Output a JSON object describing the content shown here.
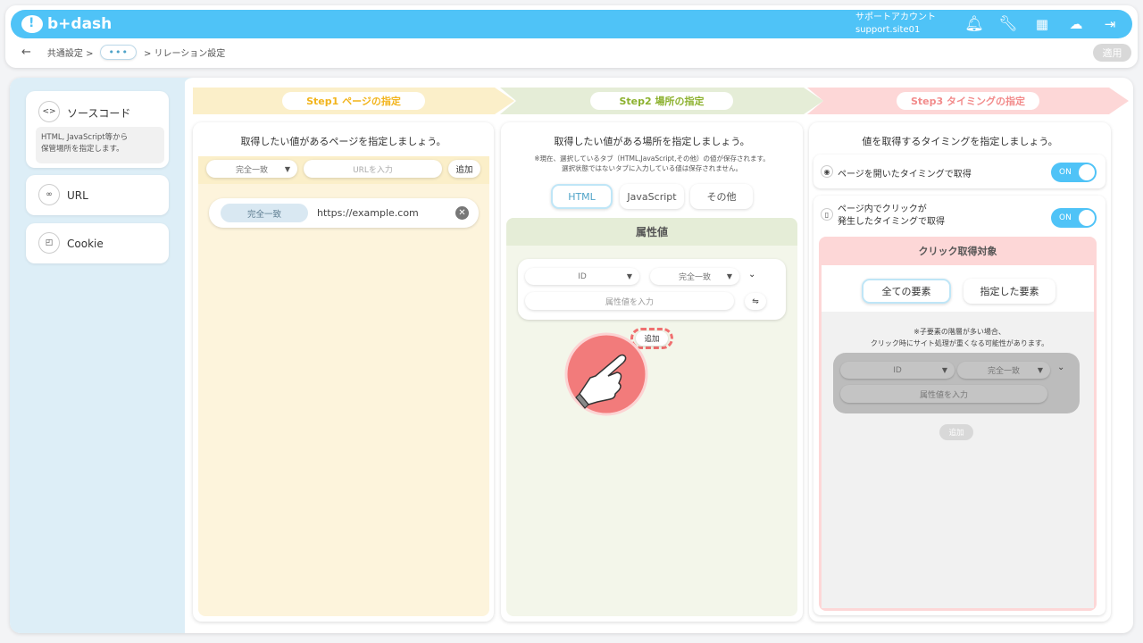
{
  "header": {
    "logo": "b+dash",
    "account_line1": "サポートアカウント",
    "account_line2": "support.site01",
    "icons": [
      "bell-icon",
      "wrench-icon",
      "grid-icon",
      "help-face-icon",
      "logout-icon"
    ]
  },
  "breadcrumb": {
    "back": "←",
    "item1": "共通設定 >",
    "more": "•••",
    "item3": "> リレーション設定"
  },
  "apply_label": "適用",
  "sidebar": {
    "items": [
      {
        "label": "ソースコード",
        "icon": "code-icon",
        "desc_line1": "HTML, JavaScript等から",
        "desc_line2": "保管場所を指定します。"
      },
      {
        "label": "URL",
        "icon": "link-icon"
      },
      {
        "label": "Cookie",
        "icon": "window-icon"
      }
    ]
  },
  "steps": [
    {
      "label": "Step1 ページの指定",
      "bg": "#fbefc9",
      "color": "#f2b41c"
    },
    {
      "label": "Step2 場所の指定",
      "bg": "#e5edd7",
      "color": "#8cb12e"
    },
    {
      "label": "Step3 タイミングの指定",
      "bg": "#fdd7d7",
      "color": "#f28b8b"
    }
  ],
  "step1": {
    "title": "取得したい値があるページを指定しましょう。",
    "match_select": "完全一致",
    "url_placeholder": "URLを入力",
    "add_label": "追加",
    "row_match": "完全一致",
    "row_url": "https://example.com"
  },
  "step2": {
    "title": "取得したい値がある場所を指定しましょう。",
    "note_line1": "※現在、選択しているタブ（HTML,JavaScript,その他）の値が保存されます。",
    "note_line2": "選択状態ではないタブに入力している値は保存されません。",
    "tabs": [
      "HTML",
      "JavaScript",
      "その他"
    ],
    "section": "属性値",
    "attr_select": "ID",
    "match_select": "完全一致",
    "value_placeholder": "属性値を入力",
    "add_label": "追加"
  },
  "step3": {
    "title": "値を取得するタイミングを指定しましょう。",
    "opt1": "ページを開いたタイミングで取得",
    "opt2_line1": "ページ内でクリックが",
    "opt2_line2": "発生したタイミングで取得",
    "toggle": "ON",
    "click_target": "クリック取得対象",
    "tabs": [
      "全ての要素",
      "指定した要素"
    ],
    "note_line1": "※子要素の階層が多い場合、",
    "note_line2": "クリック時にサイト処理が重くなる可能性があります。",
    "attr_select": "ID",
    "match_select": "完全一致",
    "value_placeholder": "属性値を入力",
    "add_label": "追加"
  }
}
